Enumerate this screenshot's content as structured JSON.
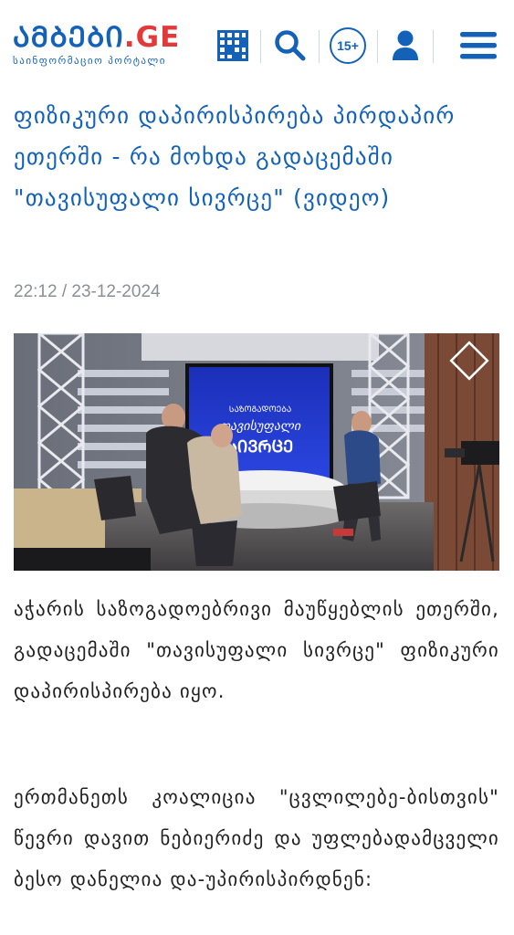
{
  "header": {
    "logo_main": "ᲐᲛᲑᲔᲑᲘ",
    "logo_ge": ".GE",
    "logo_sub": "საინფორმაციო პორტალი",
    "age_badge": "15+",
    "icons": [
      "grid-icon",
      "search-icon",
      "user-icon",
      "menu-icon"
    ],
    "accent_color": "#1462b8",
    "logo_dot_color": "#e23a3a"
  },
  "article": {
    "title": "ფიზიკური დაპირისპირება პირდაპირ ეთერში - რა მოხდა გადაცემაში \"თავისუფალი სივრცე\" (ვიდეო)",
    "date": "22:12 / 23-12-2024",
    "video": {
      "screen_line1": "ᲡᲐᲖᲝᲒᲐᲓᲝᲔᲑᲐ",
      "screen_line2": "თავისუფალი",
      "screen_line3": "ᲡᲘᲕᲠᲪᲔ"
    },
    "paragraphs": [
      "აჭარის საზოგადოებრივი მაუწყებლის ეთერში, გადაცემაში \"თავისუფალი სივრცე\" ფიზიკური დაპირისპირება იყო.",
      "ერთმანეთს კოალიცია \"ცვლილებე-ბისთვის\" წევრი დავით ნებიერიძე და უფლებადამცველი ბესო დანელია და-უპირისპირდნენ:"
    ]
  }
}
